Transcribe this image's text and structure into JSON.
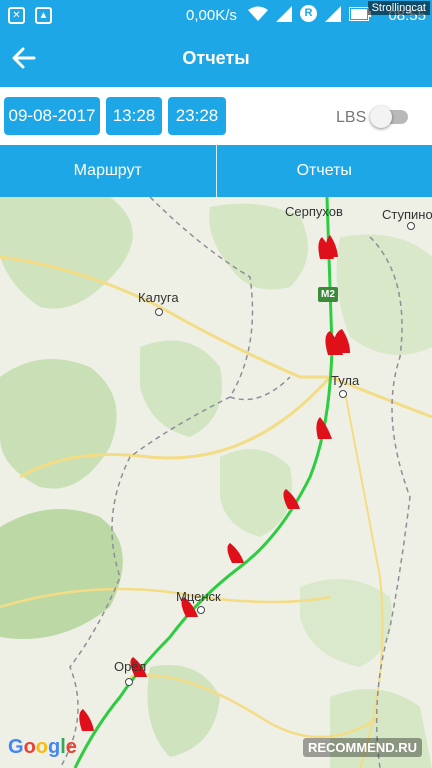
{
  "status_bar": {
    "speed": "0,00K/s",
    "time": "08:55",
    "watermark": "Strollingcat"
  },
  "toolbar": {
    "title": "Отчеты"
  },
  "filters": {
    "date": "09-08-2017",
    "time_from": "13:28",
    "time_to": "23:28",
    "lbs_label": "LBS",
    "lbs_enabled": false
  },
  "tabs": [
    {
      "label": "Маршрут"
    },
    {
      "label": "Отчеты"
    }
  ],
  "map": {
    "cities": [
      {
        "name": "Серпухов"
      },
      {
        "name": "Ступино"
      },
      {
        "name": "Калуга"
      },
      {
        "name": "Тула"
      },
      {
        "name": "Мценск"
      },
      {
        "name": "Орёл"
      }
    ],
    "highway_label": "M2",
    "logo": "Google",
    "route_color": "#2ecc40",
    "marker_color": "#e0101a"
  },
  "watermark_bottom": "RECOMMEND.RU",
  "colors": {
    "accent": "#1ea7e6"
  }
}
